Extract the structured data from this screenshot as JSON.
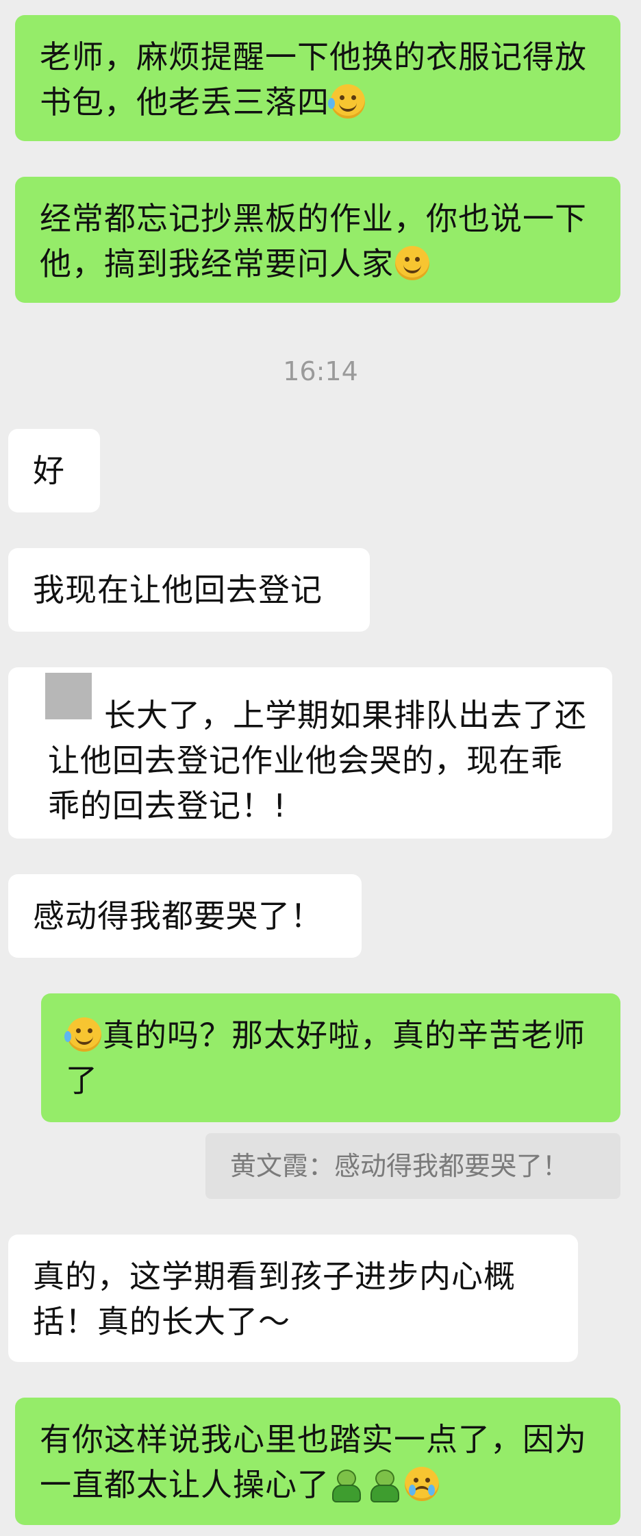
{
  "messages": [
    {
      "from": "self",
      "text": "老师，麻烦提醒一下他换的衣服记得放书包，他老丢三落四",
      "emoji": "crying-laugh-emoji"
    },
    {
      "from": "self",
      "text": "经常都忘记抄黑板的作业，你也说一下他，搞到我经常要问人家",
      "emoji": "smile-emoji"
    },
    {
      "from": "other",
      "text": "好"
    },
    {
      "from": "other",
      "text": "我现在让他回去登记"
    },
    {
      "from": "other",
      "text": "长大了，上学期如果排队出去了还让他回去登记作业他会哭的，现在乖乖的回去登记！!"
    },
    {
      "from": "other",
      "text": "感动得我都要哭了！"
    },
    {
      "from": "self",
      "text": "真的吗？那太好啦，真的辛苦老师了",
      "emoji": "crying-laugh-emoji"
    },
    {
      "from": "other",
      "text": "真的，这学期看到孩子进步内心概括！真的长大了～"
    },
    {
      "from": "self",
      "text": "有你这样说我心里也踏实一点了，因为一直都太让人操心了",
      "emoji": "figure-emoji, figure-emoji, sobbing-emoji"
    }
  ],
  "timestamp": "16:14",
  "quote": "黄文霞：感动得我都要哭了！",
  "colors": {
    "outgoing_bubble": "#95ec69",
    "incoming_bubble": "#ffffff",
    "background": "#ededed"
  }
}
